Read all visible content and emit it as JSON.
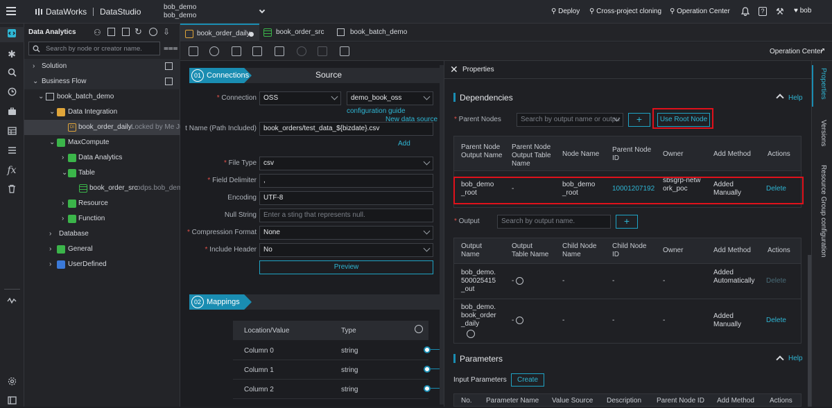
{
  "topbar": {
    "brand": "DataWorks",
    "module": "DataStudio",
    "workspace_line1": "bob_demo",
    "workspace_line2": "bob_demo",
    "deploy": "Deploy",
    "cross_project": "Cross-project cloning",
    "operation_center": "Operation Center",
    "user": "bob"
  },
  "tree": {
    "title": "Data Analytics",
    "search_placeholder": "Search by node or creator name.",
    "items": [
      {
        "label": "Solution"
      },
      {
        "label": "Business Flow"
      },
      {
        "label": "book_batch_demo"
      },
      {
        "label": "Data Integration"
      },
      {
        "label": "book_order_daily",
        "extra": "Locked by Me  Ju"
      },
      {
        "label": "MaxCompute"
      },
      {
        "label": "Data Analytics"
      },
      {
        "label": "Table"
      },
      {
        "label": "book_order_src",
        "extra": "odps.bob_dem"
      },
      {
        "label": "Resource"
      },
      {
        "label": "Function"
      },
      {
        "label": "Database"
      },
      {
        "label": "General"
      },
      {
        "label": "UserDefined"
      }
    ]
  },
  "tabs": [
    {
      "label": "book_order_daily"
    },
    {
      "label": "book_order_src"
    },
    {
      "label": "book_batch_demo"
    }
  ],
  "toolbar": {
    "operation_center": "Operation Center"
  },
  "editor": {
    "step1_num": "01",
    "step1_label": "Connections",
    "source_title": "Source",
    "connection_label": "Connection",
    "connection_type": "OSS",
    "connection_value": "demo_book_oss",
    "config_guide": "configuration guide",
    "new_data_source": "New data source",
    "filename_label": "t Name (Path Included)",
    "filename_value": "book_orders/test_data_${bizdate}.csv",
    "add": "Add",
    "filetype_label": "File Type",
    "filetype_value": "csv",
    "delim_label": "Field Delimiter",
    "delim_value": ",",
    "encoding_label": "Encoding",
    "encoding_value": "UTF-8",
    "nullstr_label": "Null String",
    "nullstr_placeholder": "Enter a sting that represents null.",
    "compress_label": "Compression Format",
    "compress_value": "None",
    "header_label": "Include Header",
    "header_value": "No",
    "preview": "Preview",
    "step2_num": "02",
    "step2_label": "Mappings",
    "map_col1": "Location/Value",
    "map_col2": "Type",
    "mappings": [
      {
        "loc": "Column 0",
        "type": "string"
      },
      {
        "loc": "Column 1",
        "type": "string"
      },
      {
        "loc": "Column 2",
        "type": "string"
      }
    ]
  },
  "props": {
    "title": "Properties",
    "dependencies": "Dependencies",
    "help": "Help",
    "parent_nodes": "Parent Nodes",
    "parent_search_placeholder": "Search by output name or outpu",
    "use_root_node": "Use Root Node",
    "parent_headers": [
      "Parent Node Output Name",
      "Parent Node Output Table Name",
      "Node Name",
      "Parent Node ID",
      "Owner",
      "Add Method",
      "Actions"
    ],
    "parent_row": {
      "output_name": "bob_demo_root",
      "table_name": "-",
      "node_name": "bob_demo_root",
      "node_id": "10001207192...",
      "owner": "sbsgrp-network_poc",
      "add_method": "Added Manually",
      "action": "Delete"
    },
    "output": "Output",
    "output_search_placeholder": "Search by output name.",
    "output_headers": [
      "Output Name",
      "Output Table Name",
      "Child Node Name",
      "Child Node ID",
      "Owner",
      "Add Method",
      "Actions"
    ],
    "output_rows": [
      {
        "name": "bob_demo.500025415_out",
        "table": "-",
        "child_name": "-",
        "child_id": "-",
        "owner": "-",
        "method": "Added Automatically",
        "action": "Delete"
      },
      {
        "name": "bob_demo.book_order_daily",
        "table": "-",
        "child_name": "-",
        "child_id": "-",
        "owner": "-",
        "method": "Added Manually",
        "action": "Delete"
      }
    ],
    "parameters": "Parameters",
    "input_params": "Input Parameters",
    "create": "Create",
    "param_headers": [
      "No.",
      "Parameter Name",
      "Value Source",
      "Description",
      "Parent Node ID",
      "Add Method",
      "Actions"
    ]
  },
  "rail_right": [
    "Properties",
    "Versions",
    "Resource Group configuration"
  ],
  "colors": {
    "accent": "#1a8db2",
    "link": "#2fb6d4",
    "highlight": "#e0111b"
  }
}
